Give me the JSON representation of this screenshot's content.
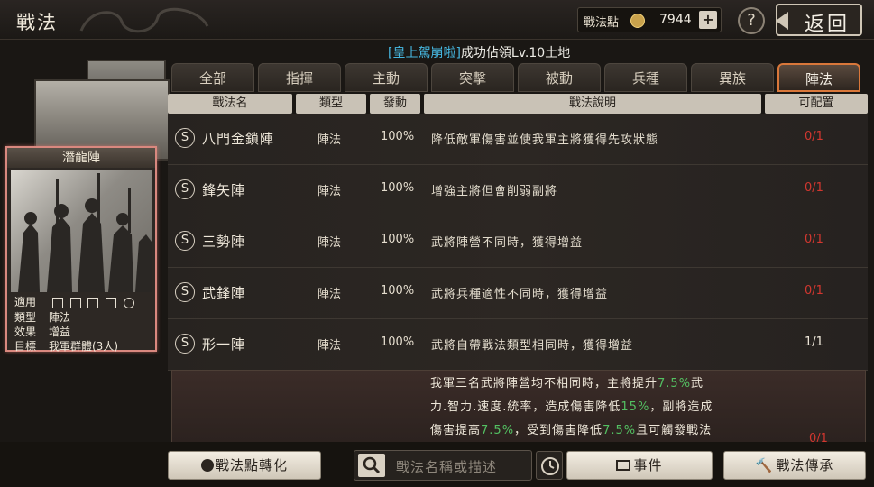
{
  "window": {
    "title": "戰法"
  },
  "currency": {
    "label": "戰法點",
    "value": "7944",
    "plus": "+"
  },
  "help_label": "?",
  "back_label": "返回",
  "notice": {
    "highlight": "[皇上駕崩啦]",
    "text": "成功佔領Lv.10土地"
  },
  "card": {
    "name": "潛龍陣",
    "info": [
      {
        "key": "適用",
        "value": ""
      },
      {
        "key": "類型",
        "value": "陣法"
      },
      {
        "key": "效果",
        "value": "增益"
      },
      {
        "key": "目標",
        "value": "我軍群體(3人)"
      }
    ],
    "unit_icons": [
      "cavalry-icon",
      "shield-icon",
      "crossbow-icon",
      "spear-icon",
      "wheel-icon"
    ]
  },
  "tabs": [
    {
      "label": "全部"
    },
    {
      "label": "指揮"
    },
    {
      "label": "主動"
    },
    {
      "label": "突擊"
    },
    {
      "label": "被動"
    },
    {
      "label": "兵種"
    },
    {
      "label": "異族"
    },
    {
      "label": "陣法",
      "active": true
    }
  ],
  "table": {
    "headers": {
      "name": "戰法名",
      "type": "類型",
      "rate": "發動",
      "desc": "戰法說明",
      "config": "可配置"
    },
    "rows": [
      {
        "badge": "S",
        "name": "八門金鎖陣",
        "type": "陣法",
        "rate": "100%",
        "desc": "降低敵軍傷害並使我軍主將獲得先攻狀態",
        "config": "0/1"
      },
      {
        "badge": "S",
        "name": "鋒矢陣",
        "type": "陣法",
        "rate": "100%",
        "desc": "增強主將但會削弱副將",
        "config": "0/1"
      },
      {
        "badge": "S",
        "name": "三勢陣",
        "type": "陣法",
        "rate": "100%",
        "desc": "武將陣營不同時，獲得增益",
        "config": "0/1"
      },
      {
        "badge": "S",
        "name": "武鋒陣",
        "type": "陣法",
        "rate": "100%",
        "desc": "武將兵種適性不同時，獲得增益",
        "config": "0/1"
      },
      {
        "badge": "S",
        "name": "形一陣",
        "type": "陣法",
        "rate": "100%",
        "desc": "武將自帶戰法類型相同時，獲得增益",
        "config": "1/1"
      }
    ]
  },
  "detail": {
    "l1a": "我軍三名武將陣營均不相同時，主將提升",
    "l1b": "7.5%",
    "l1c": "武",
    "l2a": "力.智力.速度.統率，造成傷害降低",
    "l2b": "15%",
    "l2c": "，副將造成",
    "l3a": "傷害提高",
    "l3b": "7.5%",
    "l3c": "，受到傷害降低",
    "l3d": "7.5%",
    "l3e": "且可觸發戰法",
    "config": "0/1"
  },
  "bottom": {
    "convert_label": "戰法點轉化",
    "search_placeholder": "戰法名稱或描述",
    "event_label": "事件",
    "inherit_label": "戰法傳承"
  },
  "colors": {
    "accent": "#d9773a",
    "unavailable": "#d2372f",
    "highlight_green": "#53c062",
    "notice_blue": "#46b7e0"
  }
}
